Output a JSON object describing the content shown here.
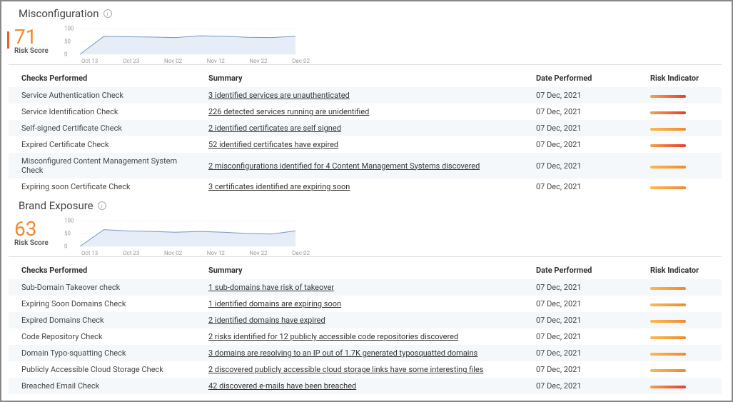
{
  "panels": [
    {
      "title": "Misconfiguration",
      "score": "71",
      "score_label": "Risk Score",
      "columns": {
        "checks": "Checks Performed",
        "summary": "Summary",
        "date": "Date Performed",
        "risk": "Risk Indicator"
      },
      "rows": [
        {
          "check": "Service Authentication Check",
          "summary": "3 identified services are unauthenticated",
          "date": "07 Dec, 2021",
          "risk": "red"
        },
        {
          "check": "Service Identification Check",
          "summary": "226 detected services running are unidentified",
          "date": "07 Dec, 2021",
          "risk": "red"
        },
        {
          "check": "Self-signed Certificate Check",
          "summary": "2 identified certificates are self signed",
          "date": "07 Dec, 2021",
          "risk": "orange"
        },
        {
          "check": "Expired Certificate Check",
          "summary": "52 identified certificates have expired",
          "date": "07 Dec, 2021",
          "risk": "red"
        },
        {
          "check": "Misconfigured Content Management System Check",
          "summary": "2 misconfigurations identified for 4 Content Management Systems discovered",
          "date": "07 Dec, 2021",
          "risk": "orange"
        },
        {
          "check": "Expiring soon Certificate Check",
          "summary": "3 certificates identified are expiring soon",
          "date": "07 Dec, 2021",
          "risk": "orange"
        }
      ]
    },
    {
      "title": "Brand Exposure",
      "score": "63",
      "score_label": "Risk Score",
      "columns": {
        "checks": "Checks Performed",
        "summary": "Summary",
        "date": "Date Performed",
        "risk": "Risk Indicator"
      },
      "rows": [
        {
          "check": "Sub-Domain Takeover check",
          "summary": "1 sub-domains have risk of takeover",
          "date": "07 Dec, 2021",
          "risk": "orange"
        },
        {
          "check": "Expiring Soon Domains Check",
          "summary": "1 identified domains are expiring soon",
          "date": "07 Dec, 2021",
          "risk": "orange"
        },
        {
          "check": "Expired Domains Check",
          "summary": "2 identified domains have expired",
          "date": "07 Dec, 2021",
          "risk": "orange"
        },
        {
          "check": "Code Repository Check",
          "summary": "2 risks identified for 12 publicly accessible code repositories discovered",
          "date": "07 Dec, 2021",
          "risk": "orange"
        },
        {
          "check": "Domain Typo-squatting Check",
          "summary": "3 domains are resolving to an IP out of 1.7K generated typosquatted domains",
          "date": "07 Dec, 2021",
          "risk": "orange"
        },
        {
          "check": "Publicly Accessible Cloud Storage Check",
          "summary": "2 discovered publicly accessible cloud storage links have some interesting files",
          "date": "07 Dec, 2021",
          "risk": "orange"
        },
        {
          "check": "Breached Email Check",
          "summary": "42 discovered e-mails have been breached",
          "date": "07 Dec, 2021",
          "risk": "red"
        }
      ]
    }
  ],
  "chart_data": [
    {
      "type": "area",
      "x": [
        "Oct 13",
        "Oct 23",
        "Nov 02",
        "Nov 12",
        "Nov 22",
        "Dec 02"
      ],
      "values": [
        0,
        70,
        68,
        67,
        65,
        72,
        70,
        66,
        65,
        70
      ],
      "ylim": [
        0,
        100
      ],
      "yticks": [
        0,
        50,
        100
      ]
    },
    {
      "type": "area",
      "x": [
        "Oct 13",
        "Oct 23",
        "Nov 02",
        "Nov 12",
        "Nov 22",
        "Dec 02"
      ],
      "values": [
        0,
        65,
        60,
        58,
        55,
        58,
        55,
        50,
        48,
        60
      ],
      "ylim": [
        0,
        100
      ],
      "yticks": [
        0,
        50,
        100
      ]
    }
  ]
}
